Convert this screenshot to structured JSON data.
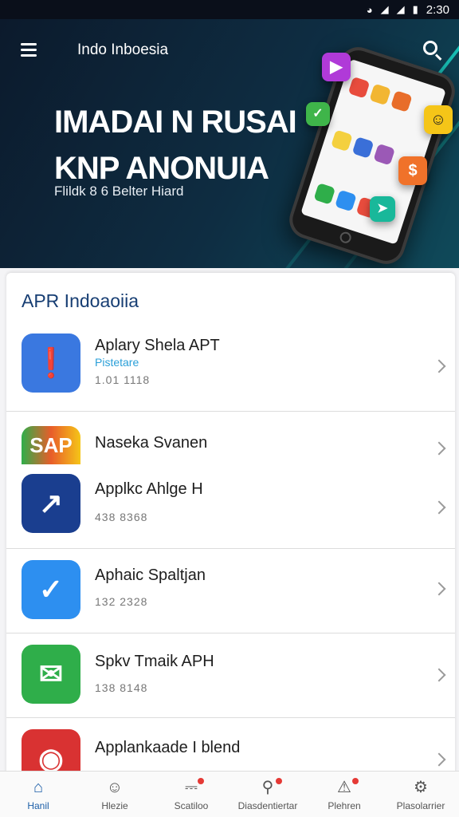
{
  "status_bar": {
    "time": "2:30",
    "icons": [
      "wifi-icon",
      "signal-icon",
      "signal-icon",
      "battery-icon"
    ]
  },
  "header": {
    "title": "Indo Inboesia",
    "headline_line1": "IMADAI N RUSAI",
    "headline_line2": "KNP ANONUIA",
    "subtitle": "Flildk 8 6 Belter Hiard"
  },
  "hero_icons": [
    "play-icon",
    "check-icon",
    "smile-icon",
    "dollar-icon",
    "arrow-icon"
  ],
  "section": {
    "title": "APR Indoaoiia"
  },
  "apps": [
    {
      "name": "Aplary Shela APT",
      "tag": "Pistetare",
      "meta": "1.01 1118",
      "icon": "chat-bubble-icon",
      "color": "#3a78e0"
    },
    {
      "name": "Naseka Svanen",
      "tag": "",
      "meta": "",
      "icon": "sap-logo-icon",
      "color": "#e85d2a"
    },
    {
      "name": "Applkc Ahlge H",
      "tag": "",
      "meta": "438 8368",
      "icon": "chart-swoosh-icon",
      "color": "#1a3e8f"
    },
    {
      "name": "Aphaic Spaltjan",
      "tag": "",
      "meta": "132 2328",
      "icon": "swoosh-icon",
      "color": "#2d8ff0"
    },
    {
      "name": "Spkv Tmaik APH",
      "tag": "",
      "meta": "138 8148",
      "icon": "message-icon",
      "color": "#2fae4a"
    },
    {
      "name": "Applankaade I blend",
      "tag": "",
      "meta": "",
      "icon": "target-icon",
      "color": "#d93232"
    }
  ],
  "nav": [
    {
      "label": "Hanil",
      "icon": "home-icon",
      "active": true
    },
    {
      "label": "Hlezie",
      "icon": "people-icon",
      "active": false
    },
    {
      "label": "Scatiloo",
      "icon": "gift-icon",
      "active": false
    },
    {
      "label": "Diasdentiertar",
      "icon": "location-icon",
      "active": false
    },
    {
      "label": "Plehren",
      "icon": "bell-icon",
      "active": false
    },
    {
      "label": "Plasolarrier",
      "icon": "settings-icon",
      "active": false
    }
  ]
}
